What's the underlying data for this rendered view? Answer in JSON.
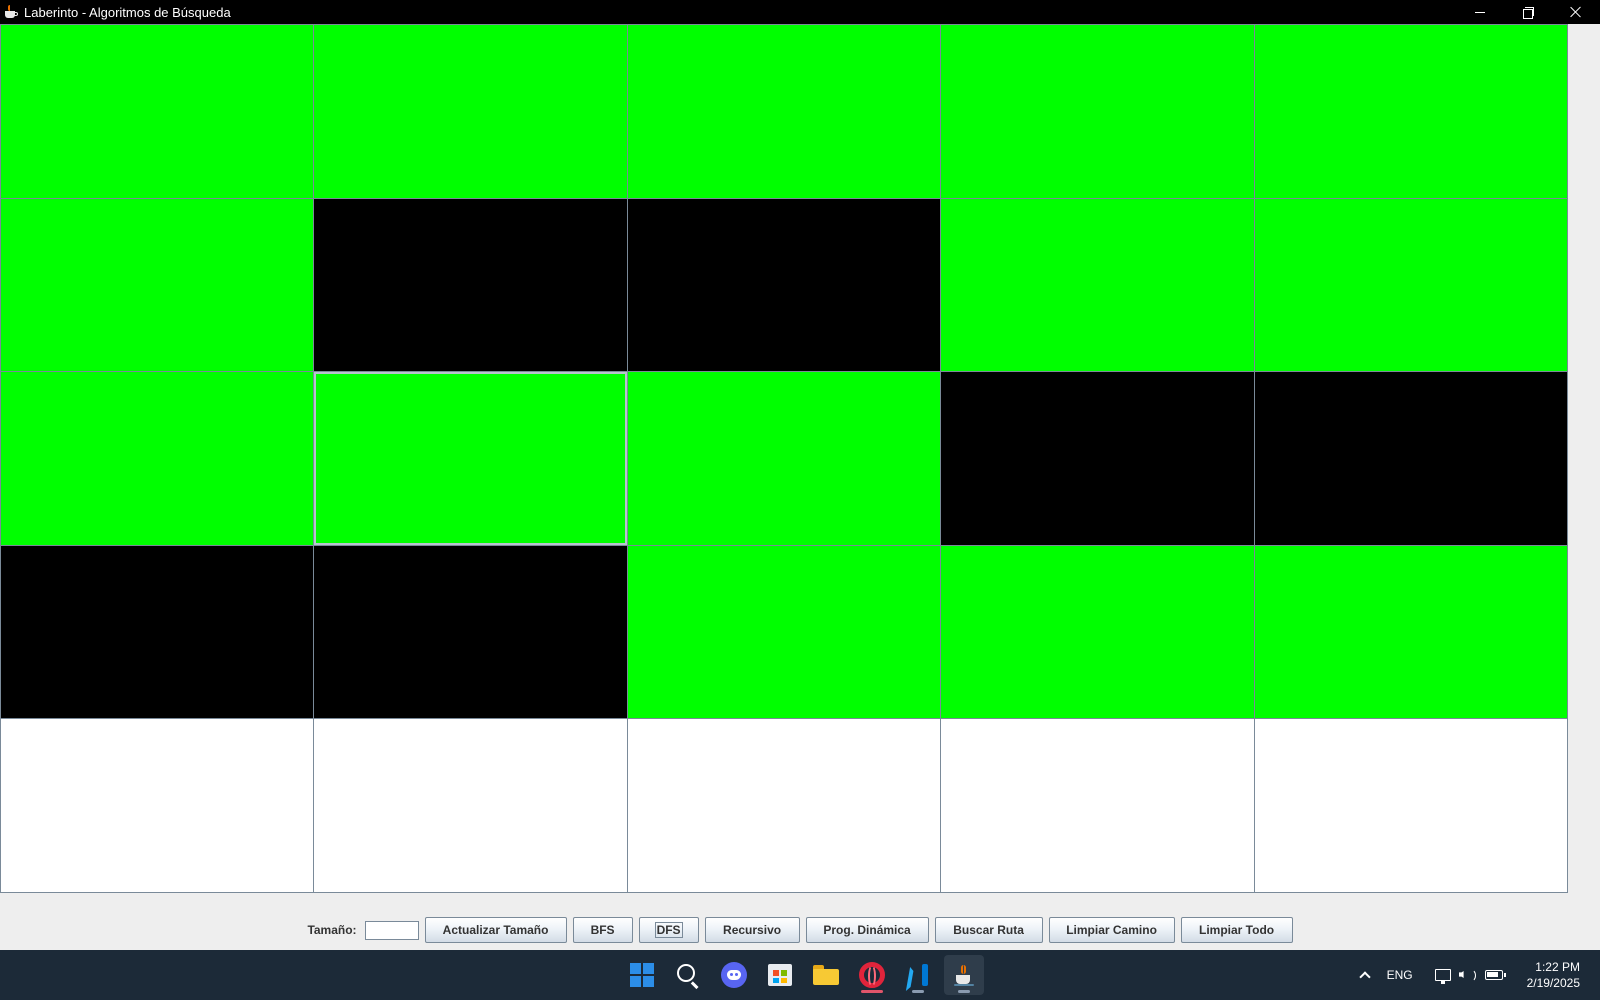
{
  "window": {
    "title": "Laberinto - Algoritmos de Búsqueda",
    "icon": "java-cup-icon"
  },
  "maze": {
    "rows": 5,
    "cols": 5,
    "cell_colors": {
      "path": "#00ff00",
      "wall": "#000000",
      "empty": "#ffffff"
    },
    "cells": [
      [
        "path",
        "path",
        "path",
        "path",
        "path"
      ],
      [
        "path",
        "wall",
        "wall",
        "path",
        "path"
      ],
      [
        "path",
        "path",
        "path",
        "wall",
        "wall"
      ],
      [
        "wall",
        "wall",
        "path",
        "path",
        "path"
      ],
      [
        "empty",
        "empty",
        "empty",
        "empty",
        "empty"
      ]
    ],
    "focused_cell": [
      2,
      1
    ]
  },
  "controls": {
    "size_label": "Tamaño:",
    "size_value": "",
    "buttons": {
      "actualizar": "Actualizar Tamaño",
      "bfs": "BFS",
      "dfs": "DFS",
      "recursivo": "Recursivo",
      "prog_dinamica": "Prog. Dinámica",
      "buscar_ruta": "Buscar Ruta",
      "limpiar_camino": "Limpiar Camino",
      "limpiar_todo": "Limpiar Todo"
    },
    "focused_button": "DFS"
  },
  "taskbar": {
    "apps": [
      "windows-start-icon",
      "search-icon",
      "discord-icon",
      "microsoft-store-icon",
      "file-explorer-icon",
      "opera-icon",
      "vscode-icon",
      "java-icon"
    ],
    "active_app": "java-icon",
    "tray": {
      "language": "ENG",
      "time": "1:22 PM",
      "date": "2/19/2025"
    }
  }
}
